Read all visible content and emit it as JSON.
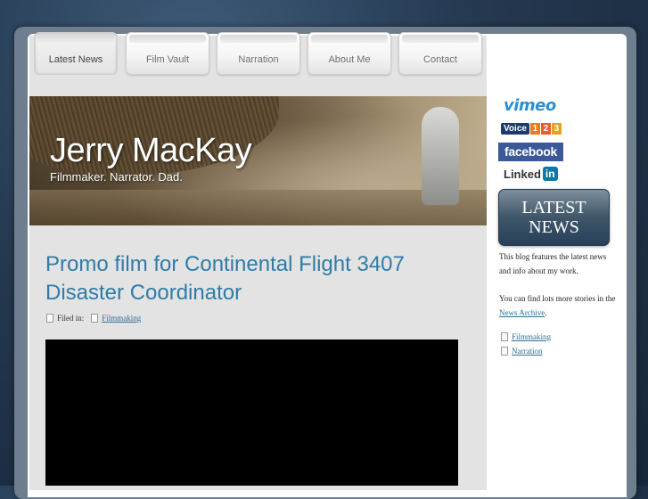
{
  "nav": {
    "tabs": [
      {
        "label": "Latest News",
        "active": true
      },
      {
        "label": "Film Vault"
      },
      {
        "label": "Narration"
      },
      {
        "label": "About Me"
      },
      {
        "label": "Contact"
      }
    ]
  },
  "header": {
    "title": "Jerry MacKay",
    "tagline": "Filmmaker. Narrator. Dad."
  },
  "post": {
    "title": "Promo film for Continental Flight 3407 Disaster Coordinator",
    "filed_label": "Filed in:",
    "category": "Filmmaking"
  },
  "sidebar": {
    "vimeo": "vimeo",
    "voice123": {
      "word": "Voice",
      "digits": [
        "1",
        "2",
        "3"
      ]
    },
    "facebook": "facebook",
    "linkedin": {
      "word": "Linked",
      "in": "in"
    },
    "latest_news_button": [
      "LATEST",
      "NEWS"
    ],
    "blurb": "This blog features the latest news and info about my work.",
    "archive_prefix": "You can find lots more stories in the",
    "archive_link": "News Archive",
    "archive_suffix": ".",
    "categories": [
      "Filmmaking",
      "Narration"
    ]
  },
  "colors": {
    "accent_title": "#2e7ca8",
    "link": "#2e6f96",
    "facebook": "#3b5998",
    "voice_digits": [
      "#f07a18",
      "#f05a28",
      "#e8a11d"
    ]
  }
}
